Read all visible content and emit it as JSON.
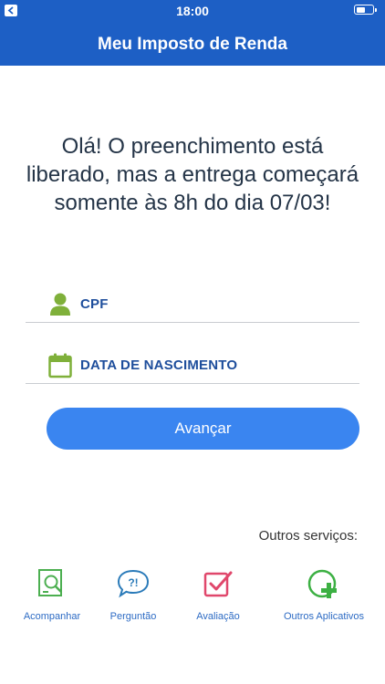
{
  "status_bar": {
    "time": "18:00"
  },
  "nav": {
    "title": "Meu Imposto de Renda"
  },
  "message": "Olá! O preenchimento está liberado, mas a entrega começará somente às 8h do dia 07/03!",
  "form": {
    "cpf_label": "CPF",
    "birth_label": "DATA DE NASCIMENTO",
    "submit_label": "Avançar"
  },
  "services": {
    "heading": "Outros serviços:",
    "items": [
      {
        "label": "Acompanhar",
        "icon": "search-document-icon",
        "color": "#4caf50"
      },
      {
        "label": "Perguntão",
        "icon": "question-bubble-icon",
        "color": "#2b7bb9"
      },
      {
        "label": "Avaliação",
        "icon": "checkbox-icon",
        "color": "#e0476b"
      },
      {
        "label": "Outros Aplicativos",
        "icon": "plus-circle-icon",
        "color": "#3cb043"
      }
    ]
  },
  "colors": {
    "header": "#1d5fc5",
    "button": "#3a85f0",
    "field_icon": "#7fb03a",
    "field_label": "#1e4e9c"
  }
}
